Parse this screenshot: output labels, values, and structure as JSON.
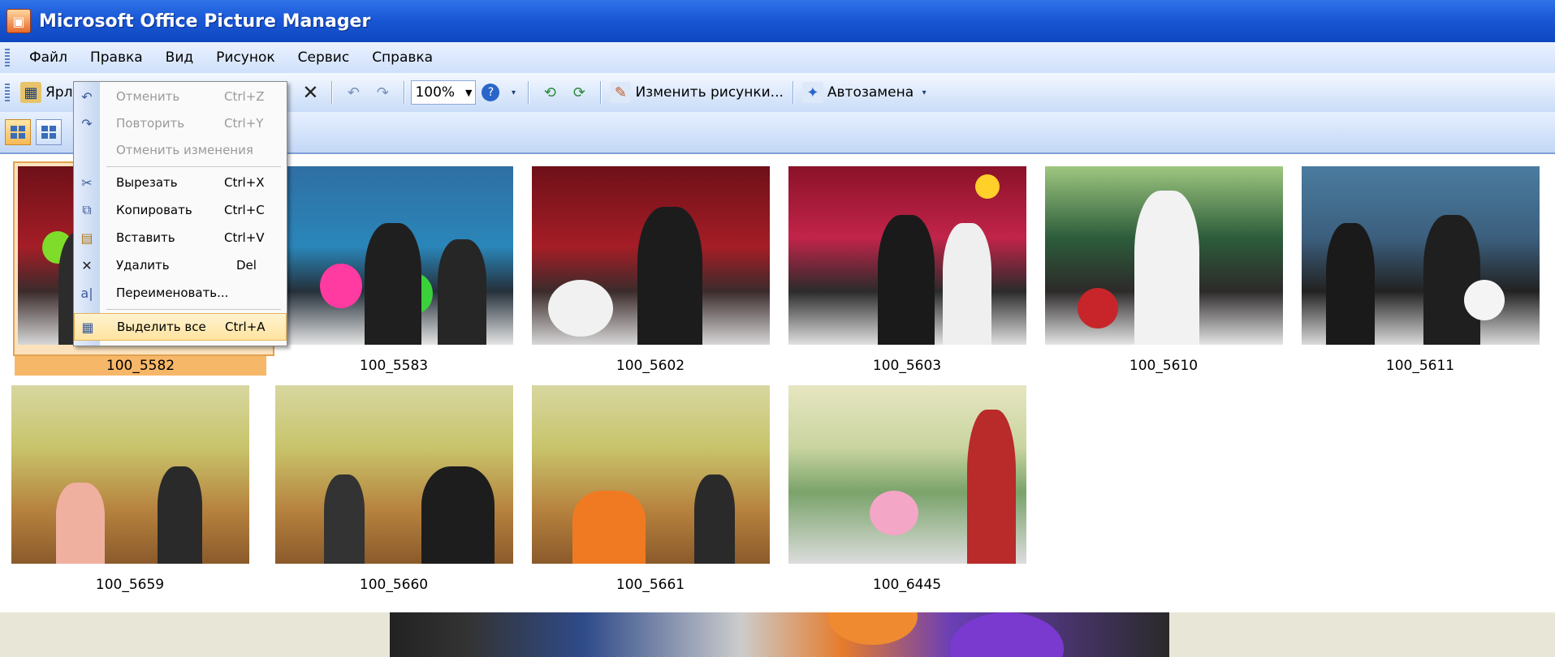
{
  "window": {
    "title": "Microsoft Office Picture Manager"
  },
  "menubar": {
    "items": [
      "Файл",
      "Правка",
      "Вид",
      "Рисунок",
      "Сервис",
      "Справка"
    ]
  },
  "toolbar": {
    "shortcut_label": "Ярл",
    "zoom": "100%",
    "edit_pictures_label": "Изменить рисунки...",
    "autocorrect_label": "Автозамена"
  },
  "edit_menu": {
    "items": [
      {
        "label": "Отменить",
        "shortcut": "Ctrl+Z",
        "icon": "undo-icon",
        "enabled": false
      },
      {
        "label": "Повторить",
        "shortcut": "Ctrl+Y",
        "icon": "redo-icon",
        "enabled": false
      },
      {
        "label": "Отменить изменения",
        "shortcut": "",
        "icon": "",
        "enabled": false
      },
      {
        "label": "Вырезать",
        "shortcut": "Ctrl+X",
        "icon": "cut-icon",
        "enabled": true
      },
      {
        "label": "Копировать",
        "shortcut": "Ctrl+C",
        "icon": "copy-icon",
        "enabled": true
      },
      {
        "label": "Вставить",
        "shortcut": "Ctrl+V",
        "icon": "paste-icon",
        "enabled": true
      },
      {
        "label": "Удалить",
        "shortcut": "Del",
        "icon": "delete-icon",
        "enabled": true
      },
      {
        "label": "Переименовать...",
        "shortcut": "",
        "icon": "rename-icon",
        "enabled": true
      },
      {
        "label": "Выделить все",
        "shortcut": "Ctrl+A",
        "icon": "select-all-icon",
        "enabled": true,
        "highlighted": true
      }
    ]
  },
  "thumbnails": [
    {
      "name": "100_5582",
      "selected": true
    },
    {
      "name": "100_5583"
    },
    {
      "name": "100_5602"
    },
    {
      "name": "100_5603"
    },
    {
      "name": "100_5610"
    },
    {
      "name": "100_5611"
    },
    {
      "name": "100_5659"
    },
    {
      "name": "100_5660"
    },
    {
      "name": "100_5661"
    },
    {
      "name": "100_6445"
    }
  ],
  "colors": {
    "titlebar": "#1a58d6",
    "selection": "#f7b768",
    "menu_highlight": "#ffe3a0"
  }
}
